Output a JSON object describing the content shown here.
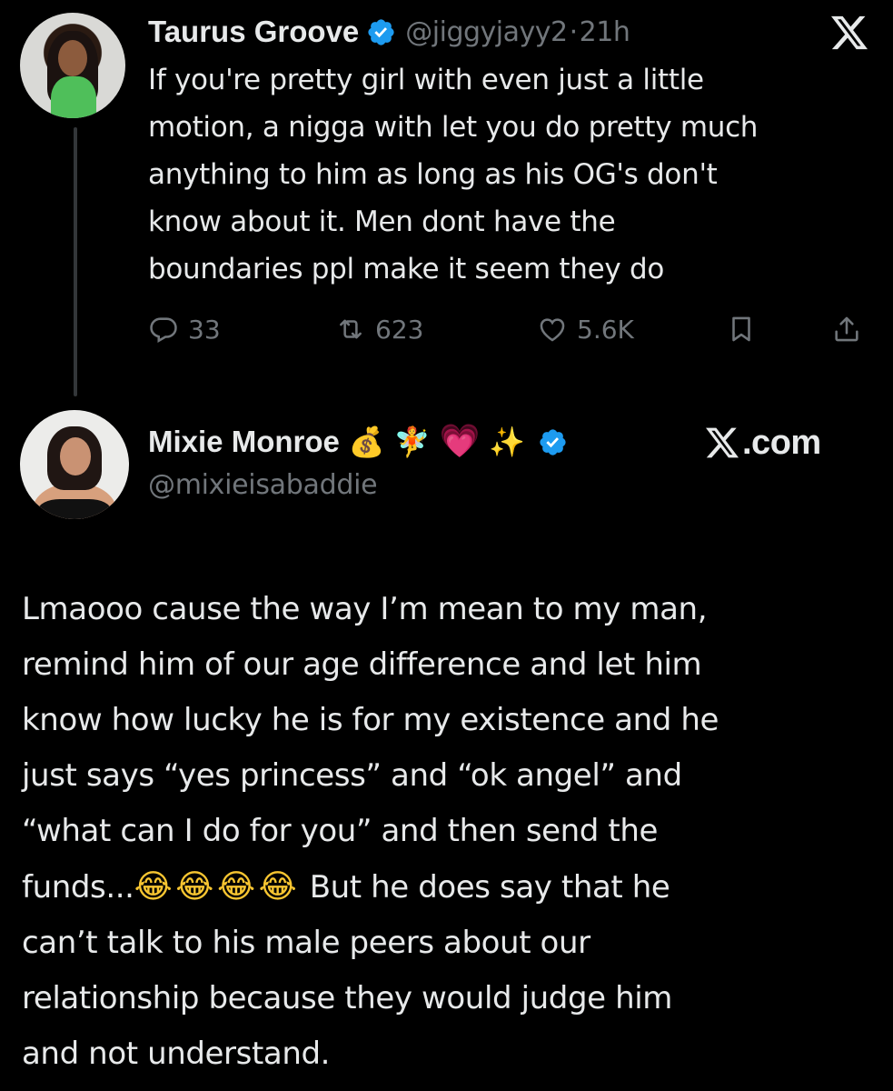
{
  "parent_tweet": {
    "display_name": "Taurus Groove",
    "handle": "@jiggyjayy2",
    "separator": "·",
    "time": "21h",
    "text_lines": [
      "If you're pretty girl with even just a little",
      "motion, a nigga with let you do pretty much",
      "anything to him as long as his OG's don't",
      "know about it. Men dont have the",
      "boundaries ppl make it seem they do"
    ],
    "replies": "33",
    "retweets": "623",
    "likes": "5.6K"
  },
  "reply_tweet": {
    "display_name": "Mixie Monroe",
    "name_emojis": [
      "💰",
      "🧚",
      "💗",
      "✨"
    ],
    "handle": "@mixieisabaddie",
    "watermark": "X.com",
    "text_lines": [
      "Lmaooo cause the way I’m mean to my man,",
      "remind him of our age difference and let him",
      "know how lucky he is for my existence and he",
      "just says “yes princess” and “ok angel” and",
      "“what can I do for you” and then send the",
      "funds...",
      "But he does say that he",
      "can’t talk to his male peers about our",
      "relationship because they would judge him",
      "and not understand."
    ],
    "inline_emojis": [
      "😂",
      "😂",
      "😂",
      "😂"
    ]
  },
  "colors": {
    "background": "#000000",
    "text": "#e7e9ea",
    "muted": "#71767b",
    "verified_blue": "#1d9bf0"
  },
  "icons": [
    "verified-badge-icon",
    "x-logo-icon",
    "reply-icon",
    "retweet-icon",
    "like-icon",
    "bookmark-icon",
    "share-icon"
  ]
}
